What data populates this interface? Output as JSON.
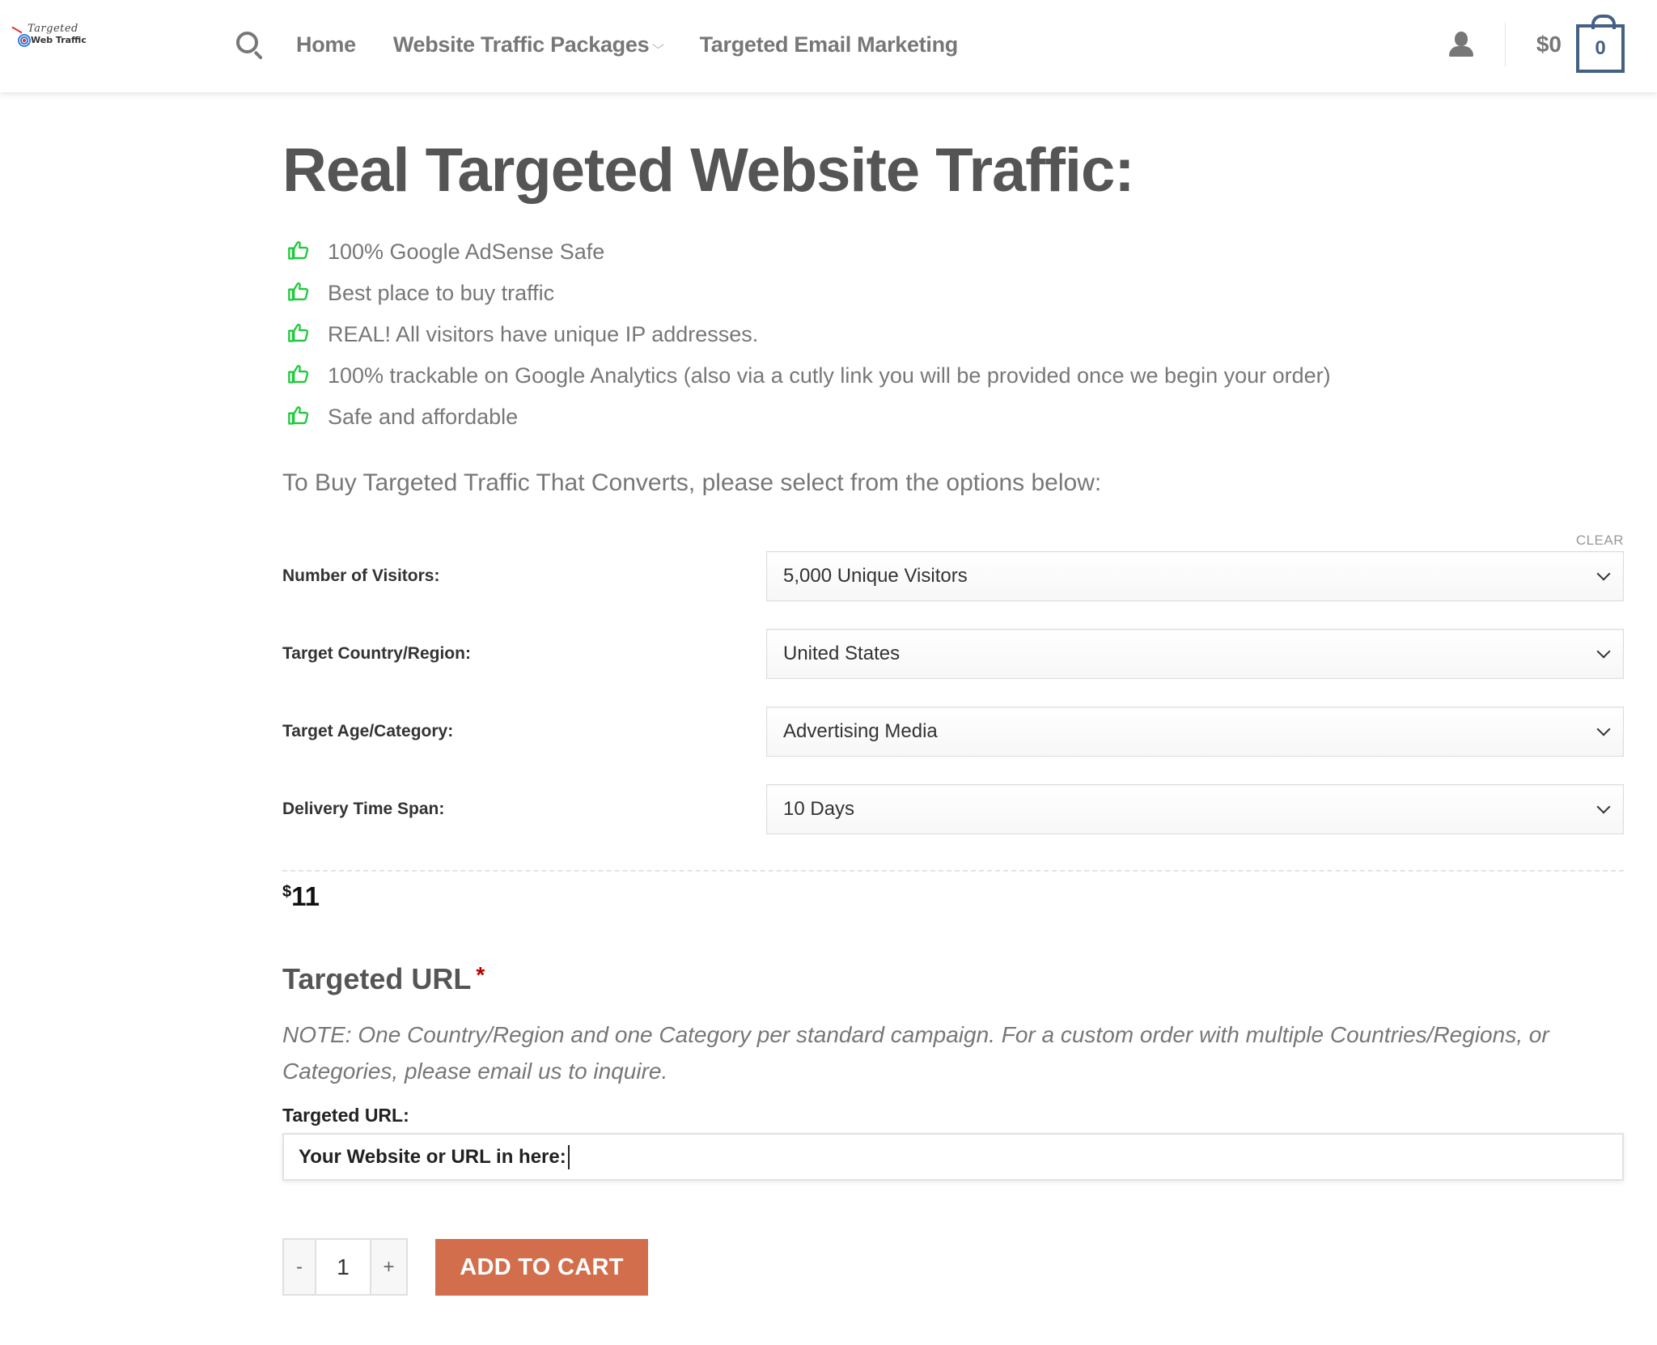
{
  "header": {
    "logo": {
      "script_text": "Targeted",
      "main_text": "Web Traffic"
    },
    "search_icon": "search-icon",
    "nav": [
      {
        "label": "Home",
        "has_dropdown": false
      },
      {
        "label": "Website Traffic Packages",
        "has_dropdown": true,
        "dropdown_icon": "⌵"
      },
      {
        "label": "Targeted Email Marketing",
        "has_dropdown": false
      }
    ],
    "account_icon": "user-icon",
    "cart_total": "$0",
    "cart_count": "0"
  },
  "main": {
    "title": "Real Targeted Website Traffic:",
    "features": [
      "100% Google AdSense Safe",
      "Best place to buy traffic",
      "REAL! All visitors have unique IP addresses.",
      "100% trackable on Google Analytics (also via a cutly link you will be provided once we begin your order)",
      "Safe and affordable"
    ],
    "intro": "To Buy Targeted Traffic That Converts, please select from the options below:",
    "clear_label": "CLEAR",
    "variations": [
      {
        "label": "Number of Visitors:",
        "value": "5,000 Unique Visitors"
      },
      {
        "label": "Target Country/Region:",
        "value": "United States"
      },
      {
        "label": "Target Age/Category:",
        "value": "Advertising Media"
      },
      {
        "label": "Delivery Time Span:",
        "value": "10 Days"
      }
    ],
    "price": {
      "currency": "$",
      "amount": "11"
    },
    "url_section": {
      "heading": "Targeted URL",
      "required_marker": "*",
      "note": "NOTE: One Country/Region and one Category per standard campaign. For a custom order with multiple Countries/Regions, or Categories, please email us to inquire.",
      "field_label": "Targeted URL:",
      "field_value": "Your Website or URL in here:"
    },
    "quantity": {
      "minus": "-",
      "value": "1",
      "plus": "+"
    },
    "add_to_cart_label": "ADD TO CART"
  },
  "colors": {
    "accent_button": "#d26e4b",
    "cart_blue": "#446084",
    "feature_icon_green": "#1fc93b",
    "required_red": "#b20000"
  }
}
